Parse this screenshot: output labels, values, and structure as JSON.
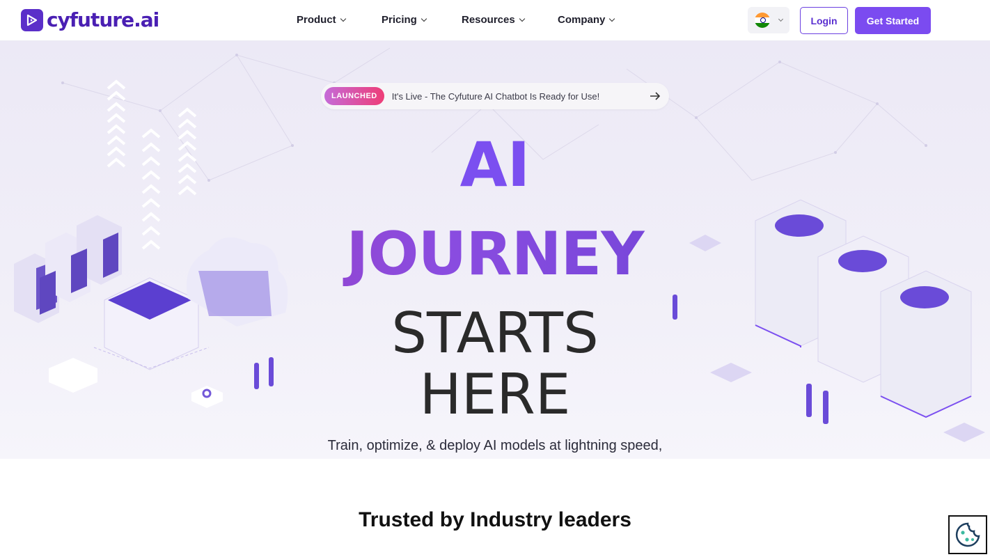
{
  "brand": {
    "name": "cyfuture.ai",
    "color": "#4a1fb3"
  },
  "nav": {
    "items": [
      {
        "label": "Product"
      },
      {
        "label": "Pricing"
      },
      {
        "label": "Resources"
      },
      {
        "label": "Company"
      }
    ],
    "language_icon": "india-flag-icon",
    "login_label": "Login",
    "cta_label": "Get Started"
  },
  "announcement": {
    "badge": "LAUNCHED",
    "text": "It's Live - The Cyfuture AI Chatbot Is Ready for Use!",
    "icon": "arrow-right-icon"
  },
  "hero": {
    "line1": "AI",
    "line2": "JOURNEY",
    "line3": "STARTS",
    "line4": "HERE",
    "subtitle": "Train, optimize, & deploy AI models at lightning speed,"
  },
  "trusted": {
    "heading": "Trusted by Industry leaders"
  },
  "cookie_icon": "cookie-icon",
  "colors": {
    "accent": "#7b4bf0",
    "badge_from": "#c56bd8",
    "badge_to": "#ee3d77"
  }
}
